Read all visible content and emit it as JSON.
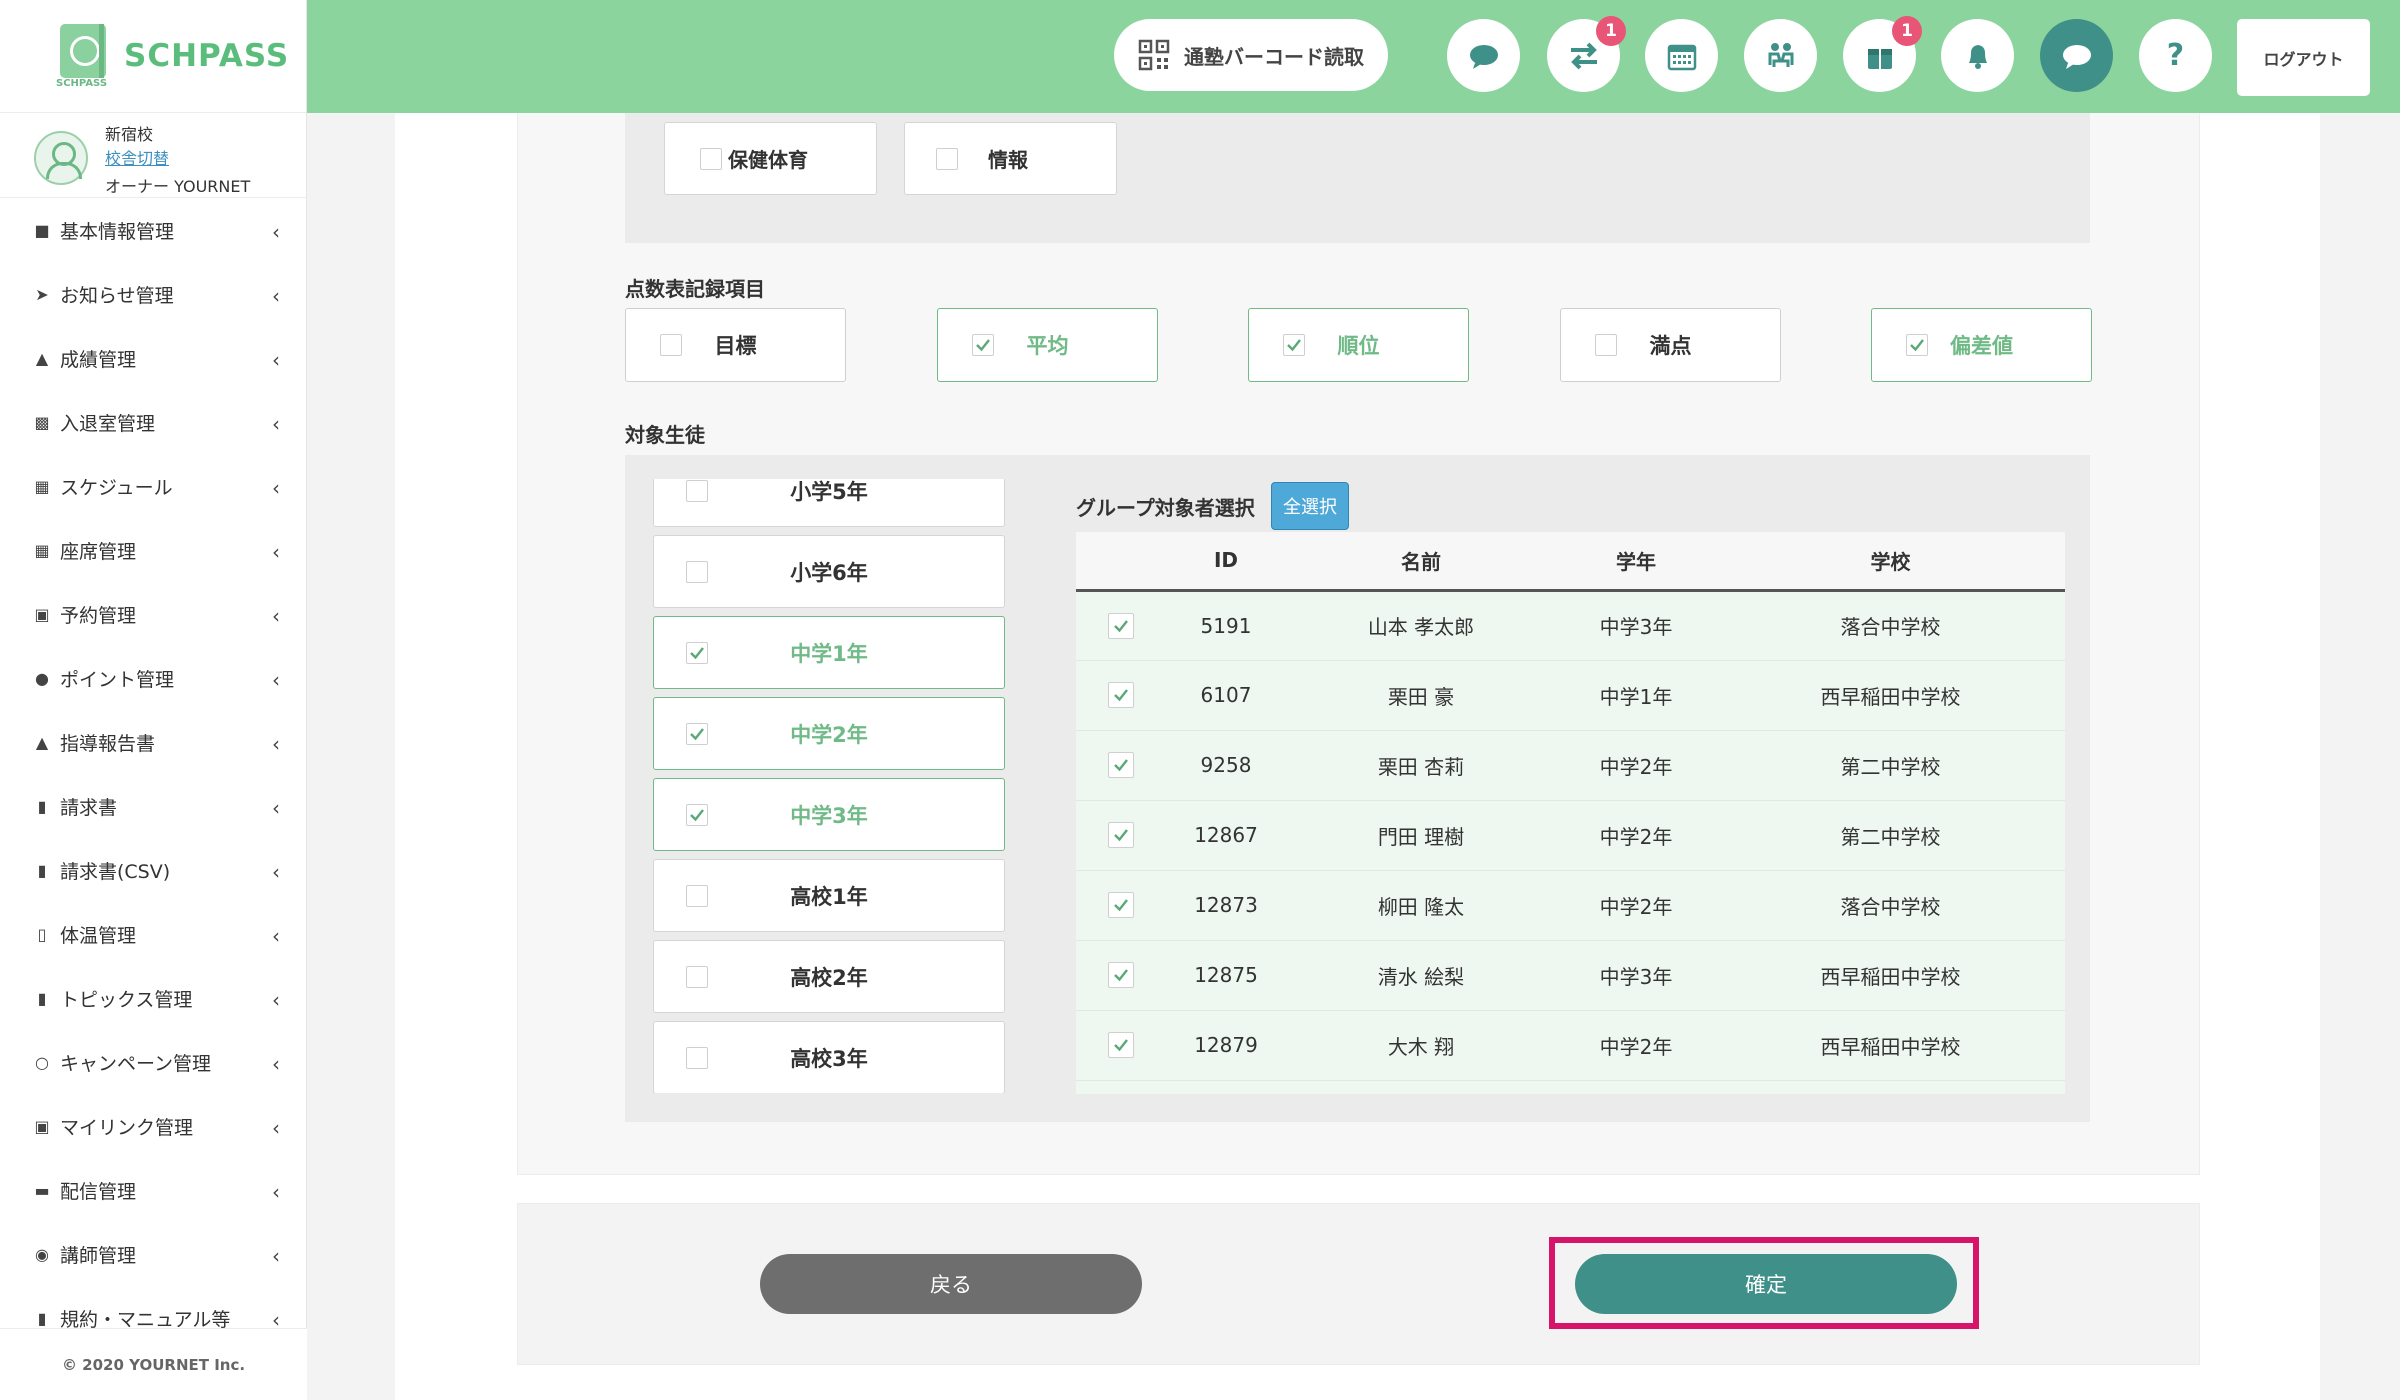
{
  "brand": {
    "name": "SCHPASS",
    "small": "SCHPASS"
  },
  "school": {
    "name": "新宿校",
    "switch_label": "校舎切替",
    "owner": "オーナー YOURNET"
  },
  "sidebar": {
    "items": [
      {
        "label": "基本情報管理",
        "icon": "user-icon"
      },
      {
        "label": "お知らせ管理",
        "icon": "paper-plane-icon"
      },
      {
        "label": "成績管理",
        "icon": "graduation-cap-icon"
      },
      {
        "label": "入退室管理",
        "icon": "car-icon"
      },
      {
        "label": "スケジュール",
        "icon": "calendar-check-icon"
      },
      {
        "label": "座席管理",
        "icon": "calendar-grid-icon"
      },
      {
        "label": "予約管理",
        "icon": "chalkboard-icon"
      },
      {
        "label": "ポイント管理",
        "icon": "point-icon"
      },
      {
        "label": "指導報告書",
        "icon": "graduation-cap-icon"
      },
      {
        "label": "請求書",
        "icon": "invoice-icon"
      },
      {
        "label": "請求書(CSV)",
        "icon": "invoice-icon"
      },
      {
        "label": "体温管理",
        "icon": "thermometer-icon"
      },
      {
        "label": "トピックス管理",
        "icon": "book-icon"
      },
      {
        "label": "キャンペーン管理",
        "icon": "person-icon"
      },
      {
        "label": "マイリンク管理",
        "icon": "id-card-icon"
      },
      {
        "label": "配信管理",
        "icon": "video-icon"
      },
      {
        "label": "講師管理",
        "icon": "user-circle-icon"
      },
      {
        "label": "規約・マニュアル等",
        "icon": "book-icon"
      }
    ],
    "footer": "© 2020 YOURNET Inc."
  },
  "header": {
    "barcode_label": "通塾バーコード読取",
    "transfer_badge": "1",
    "gift_badge": "1",
    "logout_label": "ログアウト",
    "help_label": "?"
  },
  "subjects": [
    {
      "label": "保健体育",
      "checked": false
    },
    {
      "label": "情報",
      "checked": false
    }
  ],
  "score_section": {
    "title": "点数表記録項目",
    "items": [
      {
        "label": "目標",
        "checked": false
      },
      {
        "label": "平均",
        "checked": true
      },
      {
        "label": "順位",
        "checked": true
      },
      {
        "label": "満点",
        "checked": false
      },
      {
        "label": "偏差値",
        "checked": true
      }
    ]
  },
  "students_section": {
    "title": "対象生徒",
    "grades": [
      {
        "label": "小学5年",
        "checked": false
      },
      {
        "label": "小学6年",
        "checked": false
      },
      {
        "label": "中学1年",
        "checked": true
      },
      {
        "label": "中学2年",
        "checked": true
      },
      {
        "label": "中学3年",
        "checked": true
      },
      {
        "label": "高校1年",
        "checked": false
      },
      {
        "label": "高校2年",
        "checked": false
      },
      {
        "label": "高校3年",
        "checked": false
      }
    ],
    "group_title": "グループ対象者選択",
    "select_all": "全選択",
    "columns": [
      "ID",
      "名前",
      "学年",
      "学校"
    ],
    "rows": [
      {
        "id": "5191",
        "name": "山本 孝太郎",
        "grade": "中学3年",
        "school": "落合中学校"
      },
      {
        "id": "6107",
        "name": "栗田 豪",
        "grade": "中学1年",
        "school": "西早稲田中学校"
      },
      {
        "id": "9258",
        "name": "栗田 杏莉",
        "grade": "中学2年",
        "school": "第二中学校"
      },
      {
        "id": "12867",
        "name": "門田 理樹",
        "grade": "中学2年",
        "school": "第二中学校"
      },
      {
        "id": "12873",
        "name": "柳田 隆太",
        "grade": "中学2年",
        "school": "落合中学校"
      },
      {
        "id": "12875",
        "name": "清水 絵梨",
        "grade": "中学3年",
        "school": "西早稲田中学校"
      },
      {
        "id": "12879",
        "name": "大木 翔",
        "grade": "中学2年",
        "school": "西早稲田中学校"
      }
    ]
  },
  "actions": {
    "back_label": "戻る",
    "confirm_label": "確定"
  },
  "colors": {
    "header_green": "#8bd49d",
    "accent_green": "#6fba86",
    "confirm_teal": "#3f9088",
    "highlight": "#d6146a",
    "select_all_blue": "#4ea9d8",
    "badge_pink": "#e85577"
  }
}
